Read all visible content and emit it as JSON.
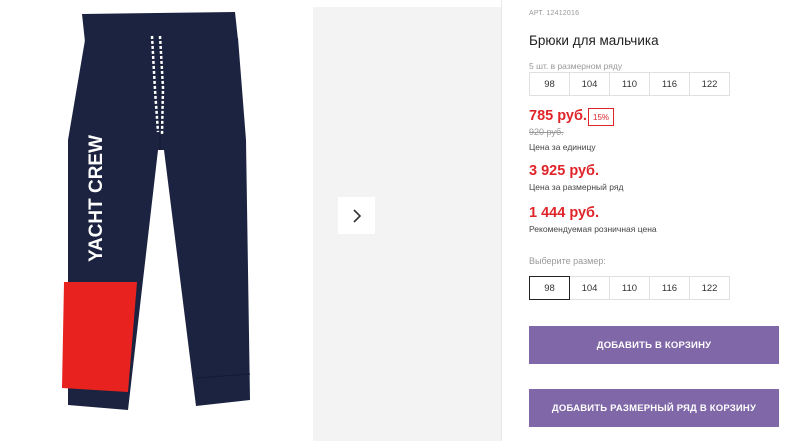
{
  "product": {
    "art": "АРТ. 12412016",
    "title": "Брюки для мальчика",
    "image_print": "YACHT CREW",
    "drawstring_print": "YACHT CREW"
  },
  "size_row": {
    "label": "5 шт. в размерном ряду",
    "sizes": [
      "98",
      "104",
      "110",
      "116",
      "122"
    ]
  },
  "prices": {
    "current": "785 руб.",
    "discount": "15%",
    "old": "920 руб.",
    "unit_caption": "Цена за единицу",
    "row_price": "3 925 руб.",
    "row_caption": "Цена за размерный ряд",
    "recommended": "1 444 руб.",
    "recommended_caption": "Рекомендуемая розничная цена"
  },
  "size_picker": {
    "label": "Выберите размер:",
    "sizes": [
      "98",
      "104",
      "110",
      "116",
      "122"
    ],
    "selected": "98"
  },
  "buttons": {
    "add_to_cart": "ДОБАВИТЬ В КОРЗИНУ",
    "add_row_to_cart": "ДОБАВИТЬ РАЗМЕРНЫЙ РЯД В КОРЗИНУ"
  },
  "colors": {
    "accent": "#7f67a8",
    "price": "#e0252a",
    "pants": "#1b2340",
    "patch": "#e8231f"
  },
  "icons": {
    "next": "chevron-right-icon"
  }
}
